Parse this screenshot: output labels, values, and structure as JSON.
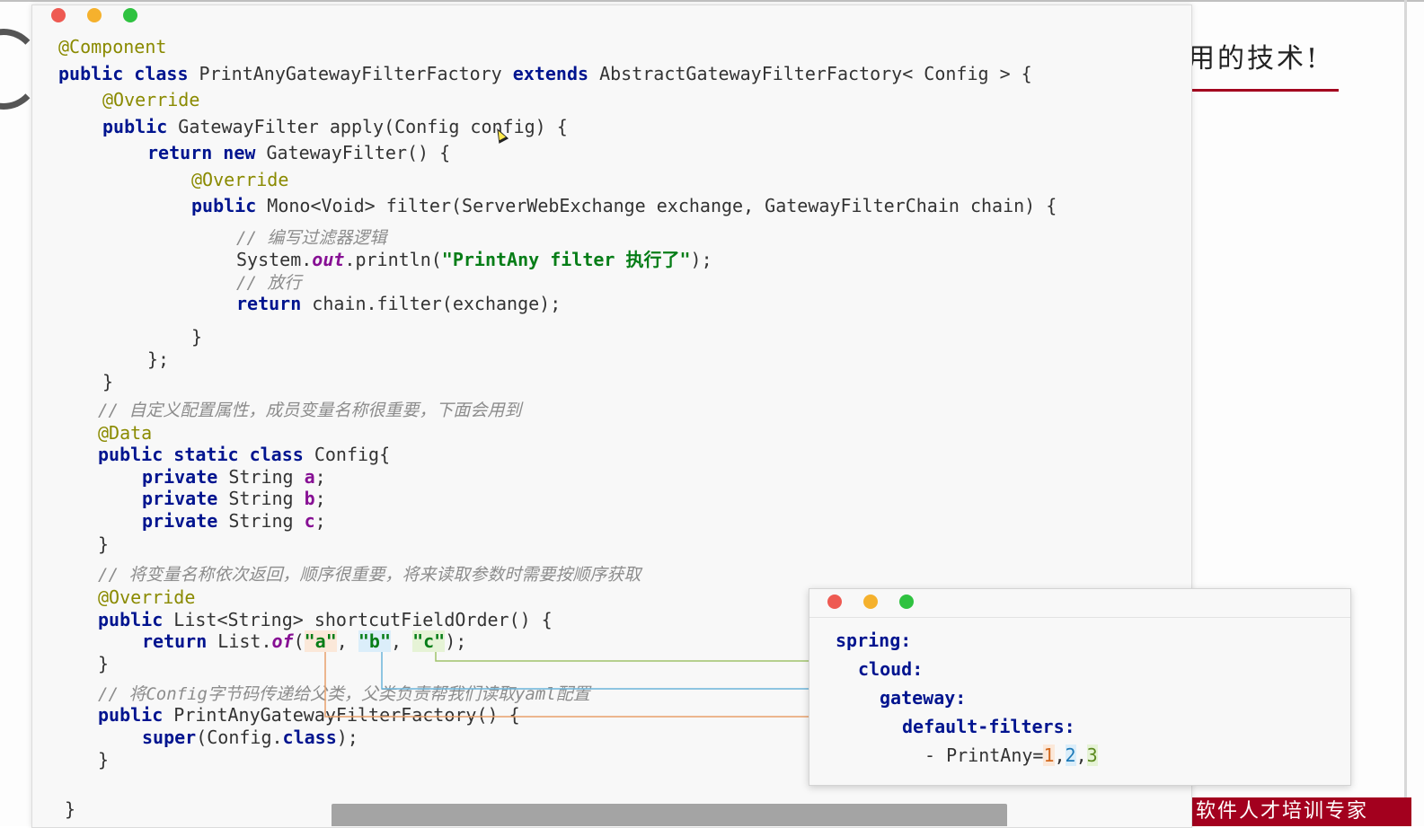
{
  "slide": {
    "heading": "用的技术!",
    "footer_brand": "软件人才培训专家"
  },
  "code_window": {
    "lines": {
      "l1_ann": "@Component",
      "l2_kw1": "public class",
      "l2_name": " PrintAnyGatewayFilterFactory ",
      "l2_kw2": "extends",
      "l2_rest": " AbstractGatewayFilterFactory< Config > {",
      "l3_ann": "@Override",
      "l4_kw": "public",
      "l4_rest": " GatewayFilter apply(Config config) {",
      "l5_kw": "return new",
      "l5_rest": " GatewayFilter() {",
      "l6_ann": "@Override",
      "l7_kw": "public",
      "l7_rest": " Mono<Void> filter(ServerWebExchange exchange, GatewayFilterChain chain) {",
      "l8_cmt": "// 编写过滤器逻辑",
      "l9_a": "System.",
      "l9_out": "out",
      "l9_b": ".println(",
      "l9_str": "\"PrintAny filter 执行了\"",
      "l9_c": ");",
      "l10_cmt": "// 放行",
      "l11_kw": "return",
      "l11_rest": " chain.filter(exchange);",
      "l12": "}",
      "l13": "};",
      "l14": "}",
      "l15_cmt": "// 自定义配置属性，成员变量名称很重要，下面会用到",
      "l16_ann": "@Data",
      "l17_kw": "public static class",
      "l17_rest": " Config{",
      "l18_kw": "private",
      "l18_type": " String ",
      "l18_field": "a",
      "l18_end": ";",
      "l19_kw": "private",
      "l19_type": " String ",
      "l19_field": "b",
      "l19_end": ";",
      "l20_kw": "private",
      "l20_type": " String ",
      "l20_field": "c",
      "l20_end": ";",
      "l21": "}",
      "l22_cmt": "// 将变量名称依次返回，顺序很重要，将来读取参数时需要按顺序获取",
      "l23_ann": "@Override",
      "l24_kw": "public",
      "l24_rest": " List<String> shortcutFieldOrder() {",
      "l25_kw": "return",
      "l25_a": " List.",
      "l25_of": "of",
      "l25_b": "(",
      "l25_s1": "\"a\"",
      "l25_c1": ", ",
      "l25_s2": "\"b\"",
      "l25_c2": ", ",
      "l25_s3": "\"c\"",
      "l25_end": ");",
      "l26": "}",
      "l27_cmt": "// 将Config字节码传递给父类，父类负责帮我们读取yaml配置",
      "l28_kw": "public",
      "l28_rest": " PrintAnyGatewayFilterFactory() {",
      "l29_kw": "super",
      "l29_a": "(Config.",
      "l29_kw2": "class",
      "l29_b": ");",
      "l30": "}",
      "l31": "}"
    }
  },
  "yaml_window": {
    "k1": "spring:",
    "k2": "cloud:",
    "k3": "gateway:",
    "k4": "default-filters:",
    "item_prefix": "- PrintAny=",
    "v1": "1",
    "sep1": ",",
    "v2": "2",
    "sep2": ",",
    "v3": "3"
  },
  "connector_colors": {
    "a": "#e8a06a",
    "b": "#6bb4d9",
    "c": "#9fc36a"
  }
}
